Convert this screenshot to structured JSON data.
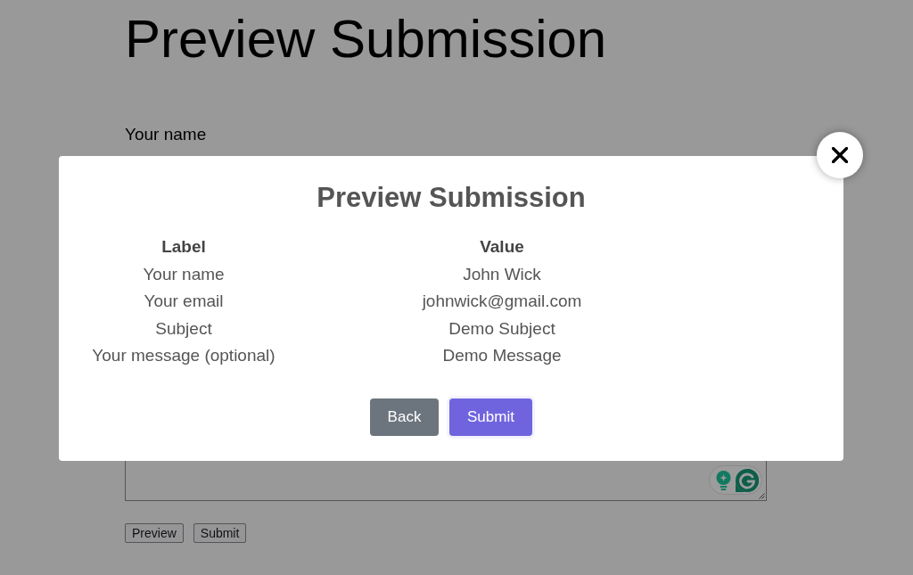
{
  "page": {
    "title": "Preview Submission",
    "labels": [
      "Your name"
    ],
    "buttons": [
      "Preview",
      "Submit"
    ]
  },
  "modal": {
    "title": "Preview Submission",
    "columns": [
      "Label",
      "Value"
    ],
    "rows": [
      [
        "Your name",
        "John Wick"
      ],
      [
        "Your email",
        "johnwick@gmail.com"
      ],
      [
        "Subject",
        "Demo Subject"
      ],
      [
        "Your message (optional)",
        "Demo Message"
      ]
    ],
    "buttons": [
      {
        "label": "Back",
        "kind": "secondary"
      },
      {
        "label": "Submit",
        "kind": "primary"
      }
    ]
  }
}
